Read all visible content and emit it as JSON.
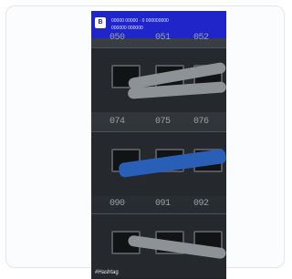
{
  "story": {
    "header_line1": "00000 00000 · 0 000000000",
    "header_line2": "000000 000000",
    "logo_text": "B",
    "caption": "#Hashtag",
    "port_numbers_row1": [
      "050",
      "051",
      "052"
    ],
    "port_numbers_row2": [
      "074",
      "075",
      "076"
    ],
    "port_numbers_row3": [
      "090",
      "091",
      "092"
    ]
  }
}
